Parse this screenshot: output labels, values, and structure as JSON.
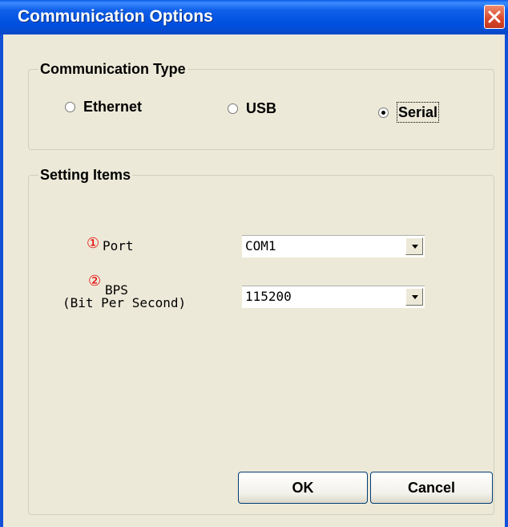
{
  "window": {
    "title": "Communication Options"
  },
  "communication_type": {
    "legend": "Communication Type",
    "options": [
      {
        "label": "Ethernet",
        "selected": false
      },
      {
        "label": "USB",
        "selected": false
      },
      {
        "label": "Serial",
        "selected": true
      }
    ]
  },
  "setting_items": {
    "legend": "Setting Items",
    "port": {
      "marker": "①",
      "label": "Port",
      "value": "COM1"
    },
    "bps": {
      "marker": "②",
      "label": "BPS",
      "sublabel": "(Bit Per Second)",
      "value": "115200"
    }
  },
  "buttons": {
    "ok": "OK",
    "cancel": "Cancel"
  }
}
